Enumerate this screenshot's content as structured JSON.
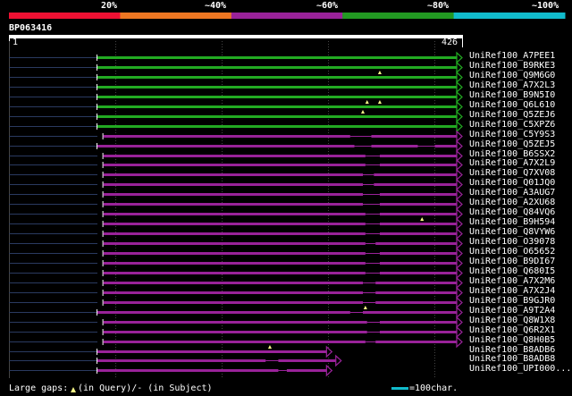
{
  "colors": {
    "background": "#000000",
    "legend": [
      "#ee1133",
      "#ee7722",
      "#992299",
      "#229922",
      "#11bbcc"
    ],
    "high": "#22aa22",
    "mid": "#992299",
    "grid": "#444444",
    "query_bar": "#ffffff",
    "insert_marker": "#ffff88",
    "scale_bar": "#11bbcc",
    "left_tail": "#2a3a60"
  },
  "legend": {
    "labels": [
      "20%",
      "~40%",
      "~60%",
      "~80%",
      "~100%"
    ]
  },
  "query": {
    "id": "BP063416",
    "start": 1,
    "end": 426
  },
  "chart_data": {
    "type": "alignment",
    "query_length": 426,
    "hits": [
      {
        "name": "UniRef100_A7PEE1",
        "identity": "high",
        "start": 1,
        "end": 426,
        "gaps": [],
        "inserts": []
      },
      {
        "name": "UniRef100_B9RKE3",
        "identity": "high",
        "start": 1,
        "end": 426,
        "gaps": [],
        "inserts": []
      },
      {
        "name": "UniRef100_Q9M6G0",
        "identity": "high",
        "start": 1,
        "end": 426,
        "gaps": [],
        "inserts": [
          335
        ]
      },
      {
        "name": "UniRef100_A7X2L3",
        "identity": "high",
        "start": 1,
        "end": 426,
        "gaps": [],
        "inserts": []
      },
      {
        "name": "UniRef100_B9N5I0",
        "identity": "high",
        "start": 1,
        "end": 426,
        "gaps": [],
        "inserts": []
      },
      {
        "name": "UniRef100_Q6L610",
        "identity": "high",
        "start": 1,
        "end": 426,
        "gaps": [],
        "inserts": [
          320,
          335
        ]
      },
      {
        "name": "UniRef100_Q5ZEJ6",
        "identity": "high",
        "start": 1,
        "end": 426,
        "gaps": [],
        "inserts": [
          315
        ]
      },
      {
        "name": "UniRef100_C5XPZ6",
        "identity": "high",
        "start": 1,
        "end": 426,
        "gaps": [],
        "inserts": []
      },
      {
        "name": "UniRef100_C5Y9S3",
        "identity": "mid",
        "start": 8,
        "end": 426,
        "gaps": [
          [
            300,
            325
          ]
        ],
        "inserts": []
      },
      {
        "name": "UniRef100_Q5ZEJ5",
        "identity": "mid",
        "start": 1,
        "end": 426,
        "gaps": [
          [
            305,
            325
          ],
          [
            380,
            400
          ]
        ],
        "inserts": []
      },
      {
        "name": "UniRef100_B6SSX2",
        "identity": "mid",
        "start": 8,
        "end": 426,
        "gaps": [
          [
            318,
            335
          ]
        ],
        "inserts": []
      },
      {
        "name": "UniRef100_A7X2L9",
        "identity": "mid",
        "start": 8,
        "end": 426,
        "gaps": [
          [
            318,
            335
          ]
        ],
        "inserts": []
      },
      {
        "name": "UniRef100_Q7XV08",
        "identity": "mid",
        "start": 8,
        "end": 426,
        "gaps": [
          [
            315,
            328
          ]
        ],
        "inserts": []
      },
      {
        "name": "UniRef100_Q01JQ0",
        "identity": "mid",
        "start": 8,
        "end": 426,
        "gaps": [
          [
            315,
            328
          ]
        ],
        "inserts": []
      },
      {
        "name": "UniRef100_A3AUG7",
        "identity": "mid",
        "start": 8,
        "end": 426,
        "gaps": [
          [
            315,
            335
          ]
        ],
        "inserts": []
      },
      {
        "name": "UniRef100_A2XU68",
        "identity": "mid",
        "start": 8,
        "end": 426,
        "gaps": [
          [
            315,
            335
          ]
        ],
        "inserts": []
      },
      {
        "name": "UniRef100_Q84VQ6",
        "identity": "mid",
        "start": 8,
        "end": 426,
        "gaps": [
          [
            318,
            335
          ]
        ],
        "inserts": []
      },
      {
        "name": "UniRef100_B9H594",
        "identity": "mid",
        "start": 8,
        "end": 426,
        "gaps": [
          [
            318,
            335
          ]
        ],
        "inserts": [
          385
        ]
      },
      {
        "name": "UniRef100_Q8VYW6",
        "identity": "mid",
        "start": 8,
        "end": 426,
        "gaps": [
          [
            318,
            335
          ]
        ],
        "inserts": []
      },
      {
        "name": "UniRef100_O39078",
        "identity": "mid",
        "start": 8,
        "end": 426,
        "gaps": [
          [
            318,
            330
          ]
        ],
        "inserts": []
      },
      {
        "name": "UniRef100_O65652",
        "identity": "mid",
        "start": 8,
        "end": 426,
        "gaps": [
          [
            318,
            335
          ]
        ],
        "inserts": []
      },
      {
        "name": "UniRef100_B9DI67",
        "identity": "mid",
        "start": 8,
        "end": 426,
        "gaps": [
          [
            318,
            335
          ]
        ],
        "inserts": []
      },
      {
        "name": "UniRef100_Q680I5",
        "identity": "mid",
        "start": 8,
        "end": 426,
        "gaps": [
          [
            318,
            335
          ]
        ],
        "inserts": []
      },
      {
        "name": "UniRef100_A7X2M6",
        "identity": "mid",
        "start": 8,
        "end": 426,
        "gaps": [
          [
            315,
            330
          ]
        ],
        "inserts": []
      },
      {
        "name": "UniRef100_A7X2J4",
        "identity": "mid",
        "start": 8,
        "end": 426,
        "gaps": [
          [
            315,
            330
          ]
        ],
        "inserts": []
      },
      {
        "name": "UniRef100_B9GJR0",
        "identity": "mid",
        "start": 8,
        "end": 426,
        "gaps": [
          [
            315,
            330
          ]
        ],
        "inserts": []
      },
      {
        "name": "UniRef100_A9T2A4",
        "identity": "mid",
        "start": 1,
        "end": 426,
        "gaps": [
          [
            300,
            315
          ]
        ],
        "inserts": [
          318
        ]
      },
      {
        "name": "UniRef100_Q8W1X8",
        "identity": "mid",
        "start": 8,
        "end": 426,
        "gaps": [
          [
            320,
            335
          ]
        ],
        "inserts": []
      },
      {
        "name": "UniRef100_Q6R2X1",
        "identity": "mid",
        "start": 8,
        "end": 426,
        "gaps": [
          [
            320,
            335
          ]
        ],
        "inserts": []
      },
      {
        "name": "UniRef100_Q8H0B5",
        "identity": "mid",
        "start": 8,
        "end": 426,
        "gaps": [
          [
            318,
            330
          ]
        ],
        "inserts": []
      },
      {
        "name": "UniRef100_B8ADB6",
        "identity": "mid",
        "start": 1,
        "end": 272,
        "gaps": [],
        "inserts": [
          205
        ]
      },
      {
        "name": "UniRef100_B8ADB8",
        "identity": "mid",
        "start": 1,
        "end": 283,
        "gaps": [
          [
            200,
            215
          ]
        ],
        "inserts": []
      },
      {
        "name": "UniRef100_UPI000...",
        "identity": "mid",
        "start": 1,
        "end": 272,
        "gaps": [
          [
            215,
            225
          ]
        ],
        "inserts": []
      }
    ]
  },
  "footer": {
    "large_gaps_prefix": "Large gaps:",
    "large_gaps_suffix": "(in Query)/- (in Subject)",
    "scale_label": "=100char."
  }
}
